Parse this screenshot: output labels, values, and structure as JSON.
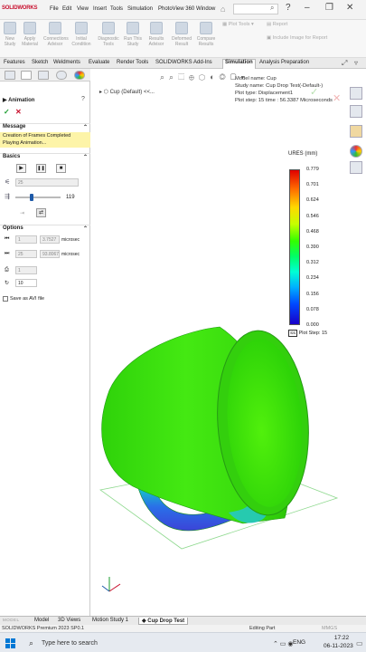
{
  "app": {
    "logo": "SOLIDWORKS"
  },
  "menu": [
    "File",
    "Edit",
    "View",
    "Insert",
    "Tools",
    "Simulation",
    "PhotoView 360",
    "Window"
  ],
  "search": {
    "placeholder": ""
  },
  "ribbon": {
    "buttons": [
      "New Study",
      "Apply Material",
      "Connections Advisor",
      "Initial Condition",
      "Diagnostic Tools",
      "Run This Study",
      "Results Advisor",
      "Deformed Result",
      "Compare Results"
    ],
    "small": [
      "Plot Tools",
      "Report",
      "Include Image for Report"
    ]
  },
  "cmd_tabs": [
    "Features",
    "Sketch",
    "Weldments",
    "Evaluate",
    "Render Tools",
    "SOLIDWORKS Add-Ins",
    "Simulation",
    "Analysis Preparation"
  ],
  "active_cmd_tab": "Simulation",
  "tree": {
    "item": "Cup (Default) <<..."
  },
  "panel": {
    "title": "Animation",
    "message_header": "Message",
    "message": "Creation of Frames Completed\nPlaying Animation...",
    "basics_header": "Basics",
    "frames_value": "25",
    "speed_value": "119",
    "speed_fraction": 0.35,
    "options_header": "Options",
    "start_frame": "1",
    "start_time": "3.7527",
    "start_unit": "microsec",
    "end_frame": "25",
    "end_time": "93.8067",
    "end_unit": "microsec",
    "copies": "1",
    "repeat": "10",
    "save_avi": "Save as AVI file"
  },
  "study_info": {
    "model": "Model name: Cup",
    "study": "Study name: Cup Drop Test(-Default-)",
    "plot_type": "Plot type: Displacement1",
    "plot_step": "Plot step: 15   time : 56.3387 Microseconds"
  },
  "legend": {
    "title": "URES (mm)",
    "ticks": [
      "0.779",
      "0.701",
      "0.624",
      "0.546",
      "0.468",
      "0.390",
      "0.312",
      "0.234",
      "0.156",
      "0.078",
      "0.000"
    ],
    "footer": "Plot Step: 15"
  },
  "bottom_tabs": [
    "MODEL",
    "Model",
    "3D Views",
    "Motion Study 1",
    "Cup Drop Test"
  ],
  "active_bottom_tab": "Cup Drop Test",
  "status": {
    "left": "SOLIDWORKS Premium 2023 SP0.1",
    "mid": "Editing Part",
    "right": "MMGS"
  },
  "taskbar": {
    "search_placeholder": "Type here to search",
    "lang": "ENG",
    "time": "17:22",
    "date": "06-11-2023"
  },
  "colors": {
    "brand": "#c8102e",
    "accent": "#1e5aa8",
    "message_bg": "#fdf4a8"
  }
}
